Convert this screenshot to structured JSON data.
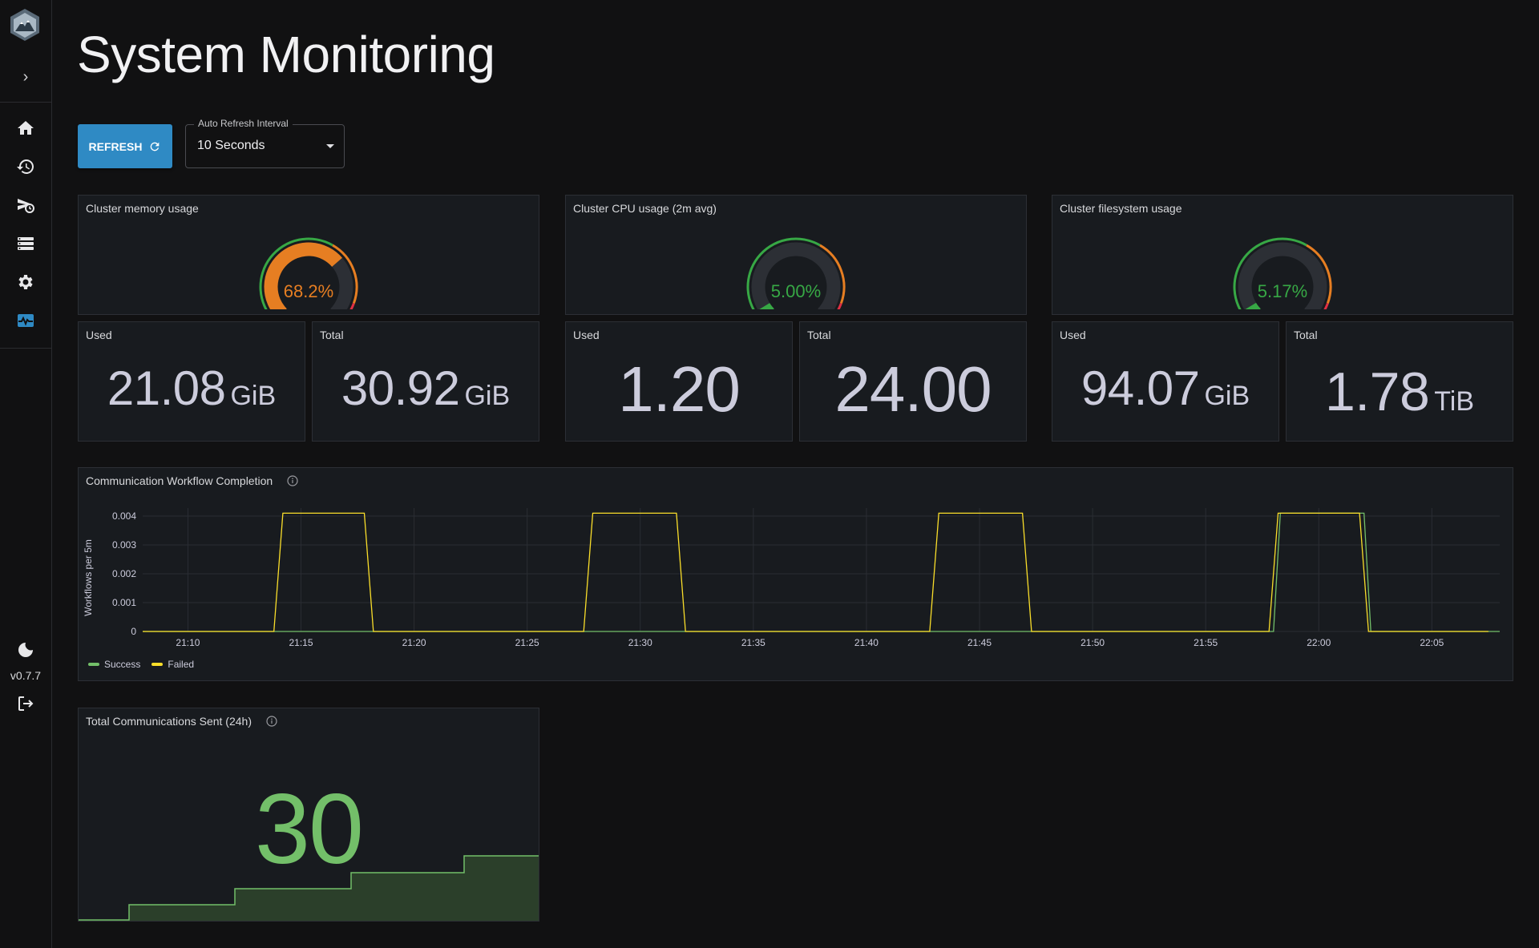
{
  "app": {
    "version": "v0.7.7"
  },
  "page": {
    "title": "System Monitoring"
  },
  "toolbar": {
    "refresh_label": "REFRESH",
    "auto_refresh": {
      "legend": "Auto Refresh Interval",
      "value": "10 Seconds"
    }
  },
  "sidebar": {
    "items": [
      {
        "name": "home-icon"
      },
      {
        "name": "history-icon"
      },
      {
        "name": "scheduled-icon"
      },
      {
        "name": "list-icon"
      },
      {
        "name": "gear-icon"
      },
      {
        "name": "monitoring-icon",
        "active": true
      }
    ],
    "bottom": [
      {
        "name": "dark-mode-icon"
      },
      {
        "name": "logout-icon"
      }
    ]
  },
  "panels": {
    "memory": {
      "title": "Cluster memory usage",
      "gauge_text": "68.2%",
      "gauge_value": 68.2,
      "color": "#e67e22",
      "used_label": "Used",
      "used_value": "21.08",
      "used_unit": "GiB",
      "total_label": "Total",
      "total_value": "30.92",
      "total_unit": "GiB"
    },
    "cpu": {
      "title": "Cluster CPU usage (2m avg)",
      "gauge_text": "5.00%",
      "gauge_value": 5.0,
      "color": "#37a845",
      "used_label": "Used",
      "used_value": "1.20",
      "total_label": "Total",
      "total_value": "24.00"
    },
    "fs": {
      "title": "Cluster filesystem usage",
      "gauge_text": "5.17%",
      "gauge_value": 5.17,
      "color": "#37a845",
      "used_label": "Used",
      "used_value": "94.07",
      "used_unit": "GiB",
      "total_label": "Total",
      "total_value": "1.78",
      "total_unit": "TiB"
    },
    "workflow": {
      "title": "Communication Workflow Completion"
    },
    "total": {
      "title": "Total Communications Sent (24h)",
      "value": "30"
    }
  },
  "chart_data": {
    "type": "line",
    "title": "Communication Workflow Completion",
    "ylabel": "Workflows per 5m",
    "xlabel": "",
    "x_ticks": [
      "21:10",
      "21:15",
      "21:20",
      "21:25",
      "21:30",
      "21:35",
      "21:40",
      "21:45",
      "21:50",
      "21:55",
      "22:00",
      "22:05"
    ],
    "y_ticks": [
      "0",
      "0.001",
      "0.002",
      "0.003",
      "0.004"
    ],
    "ylim": [
      0,
      0.004
    ],
    "grid": true,
    "legend_position": "bottom-left",
    "series": [
      {
        "name": "Success",
        "color": "#73bf69",
        "points": [
          [
            "21:08",
            0
          ],
          [
            "21:58",
            0
          ],
          [
            "21:58.3",
            0.0041
          ],
          [
            "22:02",
            0.0041
          ],
          [
            "22:02.3",
            0
          ],
          [
            "22:08",
            0
          ]
        ]
      },
      {
        "name": "Failed",
        "color": "#fade2a",
        "points": [
          [
            "21:08",
            0
          ],
          [
            "21:13.8",
            0
          ],
          [
            "21:14.2",
            0.0041
          ],
          [
            "21:17.8",
            0.0041
          ],
          [
            "21:18.2",
            0
          ],
          [
            "21:27.5",
            0
          ],
          [
            "21:27.9",
            0.0041
          ],
          [
            "21:31.6",
            0.0041
          ],
          [
            "21:32",
            0
          ],
          [
            "21:42.8",
            0
          ],
          [
            "21:43.2",
            0.0041
          ],
          [
            "21:46.9",
            0.0041
          ],
          [
            "21:47.3",
            0
          ],
          [
            "21:57.8",
            0
          ],
          [
            "21:58.2",
            0.0041
          ],
          [
            "22:01.8",
            0.0041
          ],
          [
            "22:02.2",
            0
          ],
          [
            "22:07.5",
            0
          ]
        ]
      }
    ]
  }
}
